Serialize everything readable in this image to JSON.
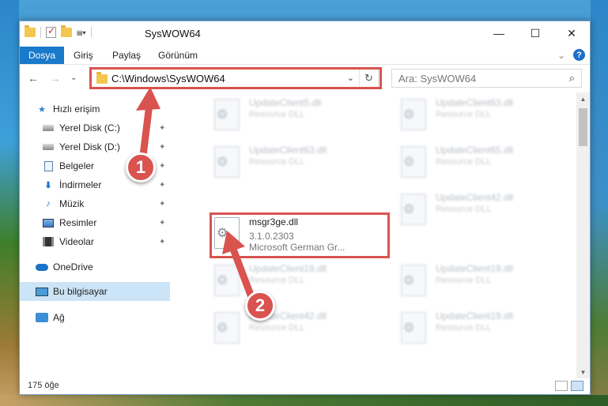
{
  "window": {
    "title": "SysWOW64",
    "controls": {
      "minimize": "—",
      "maximize": "☐",
      "close": "✕"
    }
  },
  "ribbon": {
    "tabs": [
      "Dosya",
      "Giriş",
      "Paylaş",
      "Görünüm"
    ],
    "active_tab": "Dosya",
    "expand_glyph": "⌄",
    "help": "?"
  },
  "navigation": {
    "back": "←",
    "forward": "→",
    "recent": "⌄",
    "up": "↑",
    "address": "C:\\Windows\\SysWOW64",
    "address_dropdown": "⌄",
    "refresh": "↻",
    "search_placeholder": "Ara: SysWOW64",
    "search_icon_glyph": "⌕"
  },
  "sidebar": {
    "items": [
      {
        "label": "Hızlı erişim",
        "icon": "star-icon",
        "pinned": false
      },
      {
        "label": "Yerel Disk (C:)",
        "icon": "drive-icon",
        "pinned": true
      },
      {
        "label": "Yerel Disk (D:)",
        "icon": "drive-icon",
        "pinned": true
      },
      {
        "label": "Belgeler",
        "icon": "document-icon",
        "pinned": true
      },
      {
        "label": "İndirmeler",
        "icon": "download-icon",
        "pinned": true
      },
      {
        "label": "Müzik",
        "icon": "music-icon",
        "pinned": true
      },
      {
        "label": "Resimler",
        "icon": "pictures-icon",
        "pinned": true
      },
      {
        "label": "Videolar",
        "icon": "videos-icon",
        "pinned": true
      },
      {
        "label": "OneDrive",
        "icon": "onedrive-icon",
        "pinned": false
      },
      {
        "label": "Bu bilgisayar",
        "icon": "this-pc-icon",
        "pinned": false,
        "selected": true
      },
      {
        "label": "Ağ",
        "icon": "network-icon",
        "pinned": false
      }
    ],
    "pin_glyph": "📌"
  },
  "files": {
    "blurred": [
      {
        "name": "UpdateClient5.dll",
        "desc": "Resource DLL"
      },
      {
        "name": "UpdateClient63.dll",
        "desc": "Resource DLL"
      },
      {
        "name": "UpdateClient63.dll",
        "desc": "Resource DLL"
      },
      {
        "name": "UpdateClient65.dll",
        "desc": "Resource DLL"
      },
      {
        "name": "UpdateClient42.dll",
        "desc": "Resource DLL"
      },
      {
        "name": "UpdateClient19.dll",
        "desc": "Resource DLL"
      },
      {
        "name": "UpdateClient19.dll",
        "desc": "Resource DLL"
      },
      {
        "name": "UpdateClient42.dll",
        "desc": "Resource DLL"
      },
      {
        "name": "UpdateClient19.dll",
        "desc": "Resource DLL"
      }
    ],
    "focused": {
      "name": "msgr3ge.dll",
      "version": "3.1.0.2303",
      "company": "Microsoft German Gr..."
    }
  },
  "status": {
    "item_count": "175 öğe"
  },
  "callouts": {
    "first": "1",
    "second": "2"
  },
  "colors": {
    "accent": "#1979ca",
    "highlight": "#d9534f"
  }
}
